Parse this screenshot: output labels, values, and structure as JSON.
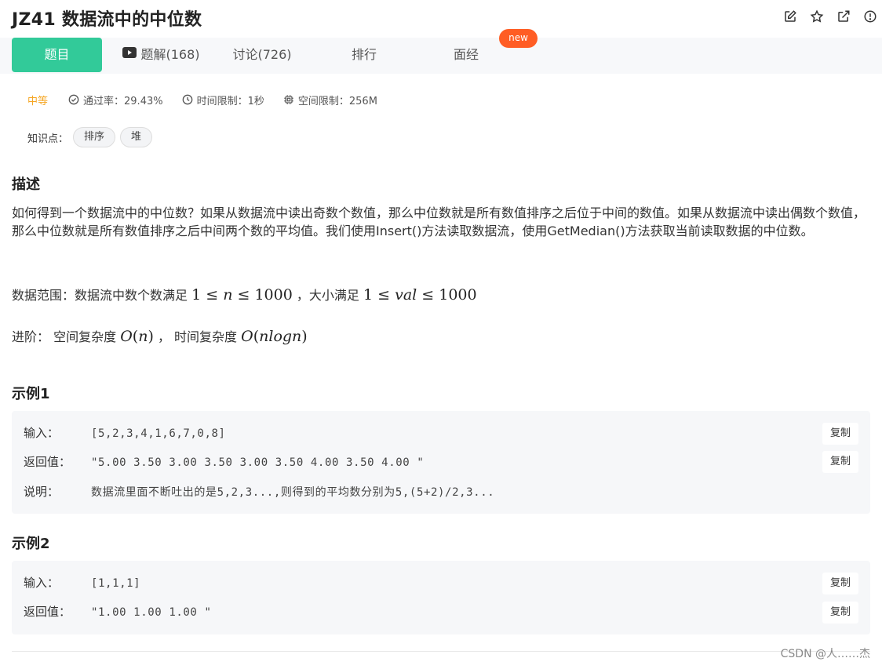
{
  "problem": {
    "title": "JZ41  数据流中的中位数"
  },
  "tabs": [
    {
      "label": "题目"
    },
    {
      "label": "题解(168)"
    },
    {
      "label": "讨论(726)"
    },
    {
      "label": "排行"
    },
    {
      "label": "面经"
    }
  ],
  "badge": {
    "new": "new"
  },
  "meta": {
    "difficulty": "中等",
    "pass_rate": "通过率：29.43%",
    "time_limit": "时间限制：1秒",
    "space_limit": "空间限制：256M"
  },
  "knowledge": {
    "label": "知识点：",
    "tags": [
      "排序",
      "堆"
    ]
  },
  "description": {
    "heading": "描述",
    "text": "如何得到一个数据流中的中位数？如果从数据流中读出奇数个数值，那么中位数就是所有数值排序之后位于中间的数值。如果从数据流中读出偶数个数值，那么中位数就是所有数值排序之后中间两个数的平均值。我们使用Insert()方法读取数据流，使用GetMedian()方法获取当前读取数据的中位数。",
    "range_prefix": "数据范围：数据流中数个数满足",
    "range_mid": "，大小满足",
    "advanced_prefix": "进阶：  空间复杂度",
    "advanced_mid": "，  时间复杂度"
  },
  "example1": {
    "heading": "示例1",
    "input_label": "输入：",
    "input_value": "[5,2,3,4,1,6,7,0,8]",
    "output_label": "返回值：",
    "output_value": "\"5.00 3.50 3.00 3.50 3.00 3.50 4.00 3.50 4.00 \"",
    "explain_label": "说明：",
    "explain_value": "数据流里面不断吐出的是5,2,3...,则得到的平均数分别为5,(5+2)/2,3...",
    "copy_label": "复制"
  },
  "example2": {
    "heading": "示例2",
    "input_label": "输入：",
    "input_value": "[1,1,1]",
    "output_label": "返回值：",
    "output_value": "\"1.00 1.00 1.00 \"",
    "copy_label": "复制"
  },
  "watermark": "CSDN @人……杰",
  "icons": [
    "edit-icon",
    "star-icon",
    "external-link-icon",
    "report-icon",
    "play-icon",
    "check-circle-icon",
    "clock-icon",
    "cpu-icon"
  ],
  "colors": {
    "accent": "#32ca99",
    "new_badge": "#ff5d24",
    "difficulty": "#f5a623"
  }
}
